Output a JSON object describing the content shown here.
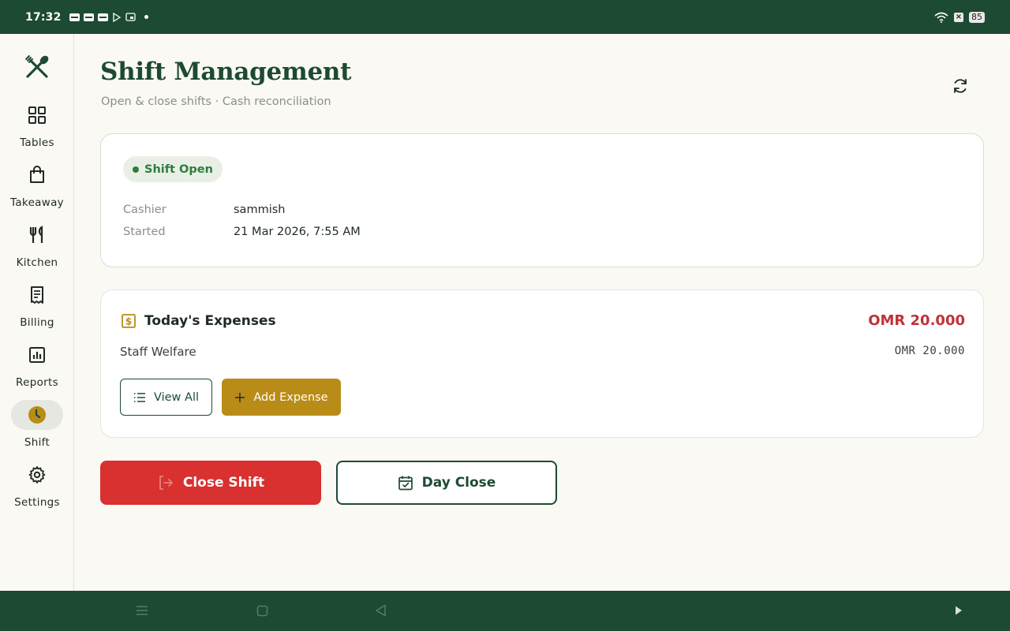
{
  "status_bar": {
    "time": "17:32",
    "battery": "85"
  },
  "sidebar": {
    "items": [
      {
        "label": "Tables",
        "icon": "grid-icon"
      },
      {
        "label": "Takeaway",
        "icon": "bag-icon"
      },
      {
        "label": "Kitchen",
        "icon": "utensils-icon"
      },
      {
        "label": "Billing",
        "icon": "receipt-icon"
      },
      {
        "label": "Reports",
        "icon": "chart-icon"
      },
      {
        "label": "Shift",
        "icon": "clock-icon",
        "active": true
      },
      {
        "label": "Settings",
        "icon": "gear-icon"
      }
    ]
  },
  "header": {
    "title": "Shift Management",
    "subtitle": "Open & close shifts · Cash reconciliation"
  },
  "shift": {
    "status": "Shift Open",
    "cashier_label": "Cashier",
    "cashier_value": "sammish",
    "started_label": "Started",
    "started_value": "21 Mar 2026, 7:55 AM"
  },
  "expenses": {
    "title": "Today's Expenses",
    "total": "OMR 20.000",
    "items": [
      {
        "name": "Staff Welfare",
        "amount": "OMR 20.000"
      }
    ],
    "view_all_label": "View All",
    "add_label": "Add Expense"
  },
  "actions": {
    "close_shift_label": "Close Shift",
    "day_close_label": "Day Close"
  },
  "colors": {
    "brand_green": "#1d4a32",
    "accent_gold": "#b98c17",
    "danger_red": "#d93030",
    "total_red": "#c0323a",
    "open_green": "#2e7d3e"
  }
}
